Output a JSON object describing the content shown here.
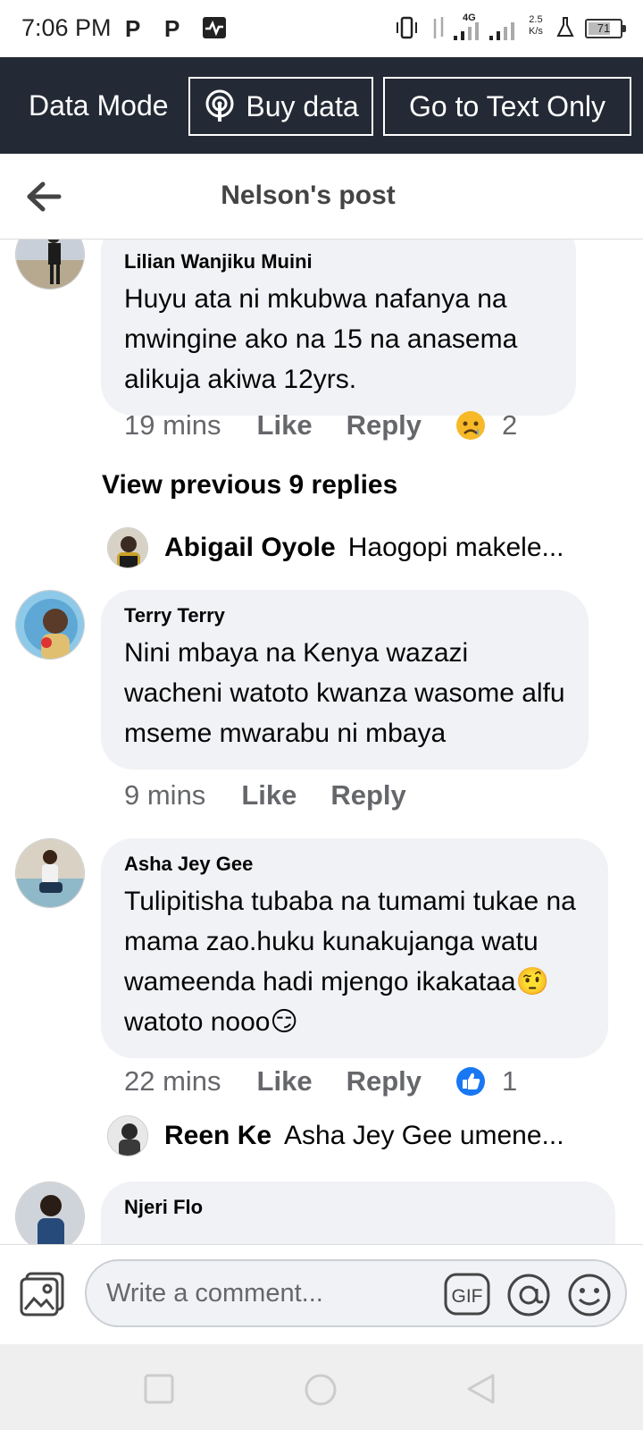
{
  "status_bar": {
    "time": "7:06 PM",
    "network": "4G",
    "speed_value": "2.5",
    "speed_unit": "K/s",
    "battery": "71",
    "battery_level": 0.71
  },
  "data_bar": {
    "mode_label": "Data Mode",
    "buy_label": "Buy data",
    "text_only_label": "Go to Text Only"
  },
  "header": {
    "title": "Nelson's post"
  },
  "comments": [
    {
      "author": "Lilian Wanjiku Muini",
      "text": "Huyu ata ni mkubwa nafanya na mwingine ako na 15 na anasema alikuja akiwa 12yrs.",
      "time": "19 mins",
      "like": "Like",
      "reply": "Reply",
      "reaction_icon": "sad-face-icon",
      "reaction_count": "2"
    },
    {
      "author": "Terry Terry",
      "text": "Nini mbaya na Kenya wazazi wacheni watoto kwanza wasome alfu mseme mwarabu ni mbaya",
      "time": "9 mins",
      "like": "Like",
      "reply": "Reply"
    },
    {
      "author": "Asha Jey Gee",
      "text": "Tulipitisha tubaba na tumami tukae na mama zao.huku kunakujanga watu wameenda hadi mjengo ikakataa🤨watoto nooo😏",
      "time": "22 mins",
      "like": "Like",
      "reply": "Reply",
      "reaction_icon": "thumbs-up-icon",
      "reaction_count": "1"
    },
    {
      "author": "Njeri Flo"
    }
  ],
  "view_previous": "View previous 9 replies",
  "replies": [
    {
      "name": "Abigail Oyole",
      "text": "Haogopi makele..."
    },
    {
      "name": "Reen Ke",
      "text": "Asha Jey Gee umene..."
    }
  ],
  "composer": {
    "placeholder": "Write a comment..."
  },
  "colors": {
    "data_bar_bg": "#242a35",
    "bubble_bg": "#f0f2f5",
    "like_blue": "#1877f2",
    "meta_gray": "#65676b"
  }
}
